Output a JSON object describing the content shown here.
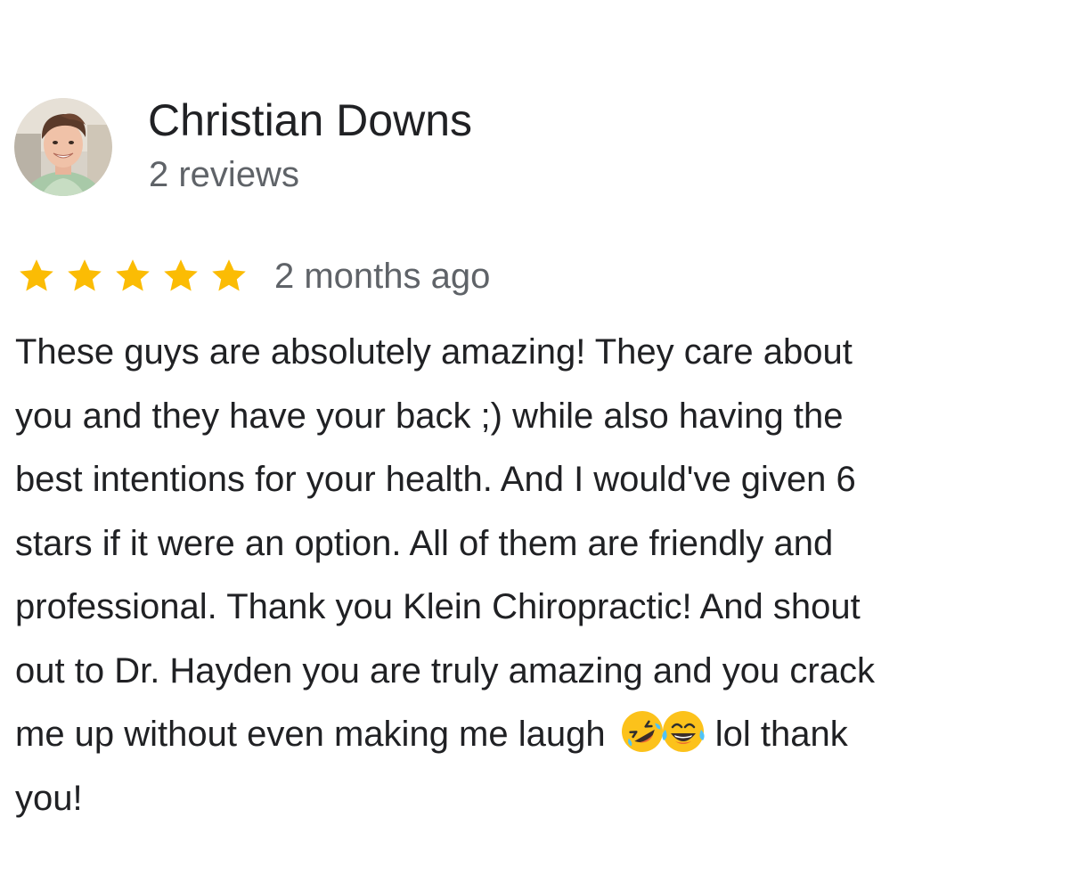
{
  "reviewer": {
    "name": "Christian Downs",
    "review_count": "2 reviews"
  },
  "rating": {
    "stars": 5,
    "max_stars": 5,
    "color": "#fbbc04"
  },
  "review": {
    "date": "2 months ago",
    "lines": [
      "These guys are absolutely amazing! They care about",
      "you and they have your back ;) while also having the",
      "best intentions for your health. And I would've given 6",
      "stars if it were an option. All of them are friendly and",
      "professional. Thank you Klein Chiropractic! And shout",
      "out to Dr. Hayden you are truly amazing and you crack"
    ],
    "line7_before_emoji": "me up without even making me laugh",
    "emojis": [
      "rolling-on-floor-laughing-emoji",
      "tears-of-joy-emoji"
    ],
    "line7_after_emoji": "lol thank",
    "line8": "you!"
  },
  "colors": {
    "text_primary": "#202124",
    "text_secondary": "#5f6368",
    "background": "#ffffff"
  }
}
